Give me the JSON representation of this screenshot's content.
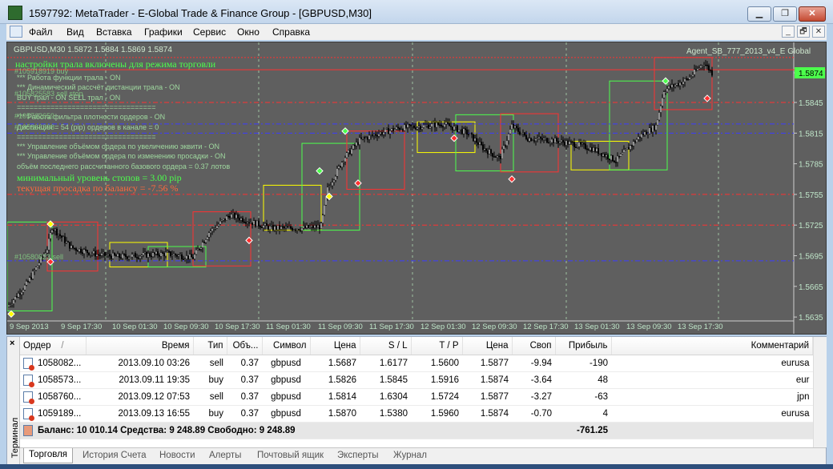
{
  "window": {
    "title": "1597792: MetaTrader - E-Global Trade & Finance Group - [GBPUSD,M30]",
    "min": "▁",
    "max": "❐",
    "close": "✕"
  },
  "menu": [
    "Файл",
    "Вид",
    "Вставка",
    "Графики",
    "Сервис",
    "Окно",
    "Справка"
  ],
  "mdi": {
    "min": "_",
    "restore": "🗗",
    "close": "✕"
  },
  "chart": {
    "symbol_line": "GBPUSD,M30  1.5872 1.5884 1.5869 1.5874",
    "expert": "Agent_SB_777_2013_v4_E Global",
    "price_labels": [
      "1.5874",
      "1.5845",
      "1.5815",
      "1.5785",
      "1.5755",
      "1.5725",
      "1.5695",
      "1.5665",
      "1.5635"
    ],
    "time_labels": [
      "9 Sep 2013",
      "9 Sep 17:30",
      "10 Sep 01:30",
      "10 Sep 09:30",
      "10 Sep 17:30",
      "11 Sep 01:30",
      "11 Sep 09:30",
      "11 Sep 17:30",
      "12 Sep 01:30",
      "12 Sep 09:30",
      "12 Sep 17:30",
      "13 Sep 01:30",
      "13 Sep 09:30",
      "13 Sep 17:30"
    ],
    "info_green": [
      "настройки трала включены для режима  торговли",
      "минимальный уровень стопов =  3.00 pip"
    ],
    "info_red": "текущая просадка по балансу =  -7.56 %",
    "info_small": [
      "*** Работа функции трала -   ON",
      "*** Динамический рассчёт дистанции трала -   ON",
      "BUY трал -   ON    SELL трал -   ON",
      "=================================",
      "*** Работа фильтра плотности ордеров -   ON",
      "Дистанция = 54 (pip) ордеров в канале =  0",
      "=================================",
      "*** Управление объёмом ордера по увеличению эквити -   ON",
      "*** Управление объёмом ордера по изменению просадки -   ON",
      "объём последнего рассчитанного базового ордера =  0.37 лотов"
    ],
    "order_labels": [
      "#105918919 buy",
      "#105825583 sell stop",
      "#105762659",
      "#105863398",
      "#10580823 sell"
    ]
  },
  "terminal": {
    "close": "×",
    "label": "Терминал",
    "headers": [
      "Ордер",
      "/",
      "Время",
      "Тип",
      "Объ...",
      "Символ",
      "Цена",
      "S / L",
      "T / P",
      "Цена",
      "Своп",
      "Прибыль",
      "Комментарий"
    ],
    "rows": [
      {
        "order": "1058082...",
        "time": "2013.09.10 03:26",
        "type": "sell",
        "vol": "0.37",
        "sym": "gbpusd",
        "price": "1.5687",
        "sl": "1.6177",
        "tp": "1.5600",
        "cur": "1.5877",
        "swap": "-9.94",
        "profit": "-190",
        "comment": "eurusa"
      },
      {
        "order": "1058573...",
        "time": "2013.09.11 19:35",
        "type": "buy",
        "vol": "0.37",
        "sym": "gbpusd",
        "price": "1.5826",
        "sl": "1.5845",
        "tp": "1.5916",
        "cur": "1.5874",
        "swap": "-3.64",
        "profit": "48",
        "comment": "eur"
      },
      {
        "order": "1058760...",
        "time": "2013.09.12 07:53",
        "type": "sell",
        "vol": "0.37",
        "sym": "gbpusd",
        "price": "1.5814",
        "sl": "1.6304",
        "tp": "1.5724",
        "cur": "1.5877",
        "swap": "-3.27",
        "profit": "-63",
        "comment": "jpn"
      },
      {
        "order": "1059189...",
        "time": "2013.09.13 16:55",
        "type": "buy",
        "vol": "0.37",
        "sym": "gbpusd",
        "price": "1.5870",
        "sl": "1.5380",
        "tp": "1.5960",
        "cur": "1.5874",
        "swap": "-0.70",
        "profit": "4",
        "comment": "eurusa"
      }
    ],
    "balance": "Баланс: 10 010.14  Средства: 9 248.89  Свободно: 9 248.89",
    "total_profit": "-761.25",
    "tabs": [
      "Торговля",
      "История Счета",
      "Новости",
      "Алерты",
      "Почтовый ящик",
      "Эксперты",
      "Журнал"
    ]
  },
  "colors": {
    "chart_bg": "#5f5f5f",
    "green": "#4cff4c",
    "red": "#ff3c3c",
    "yellow": "#ffff00",
    "text": "#cfe8cf"
  }
}
